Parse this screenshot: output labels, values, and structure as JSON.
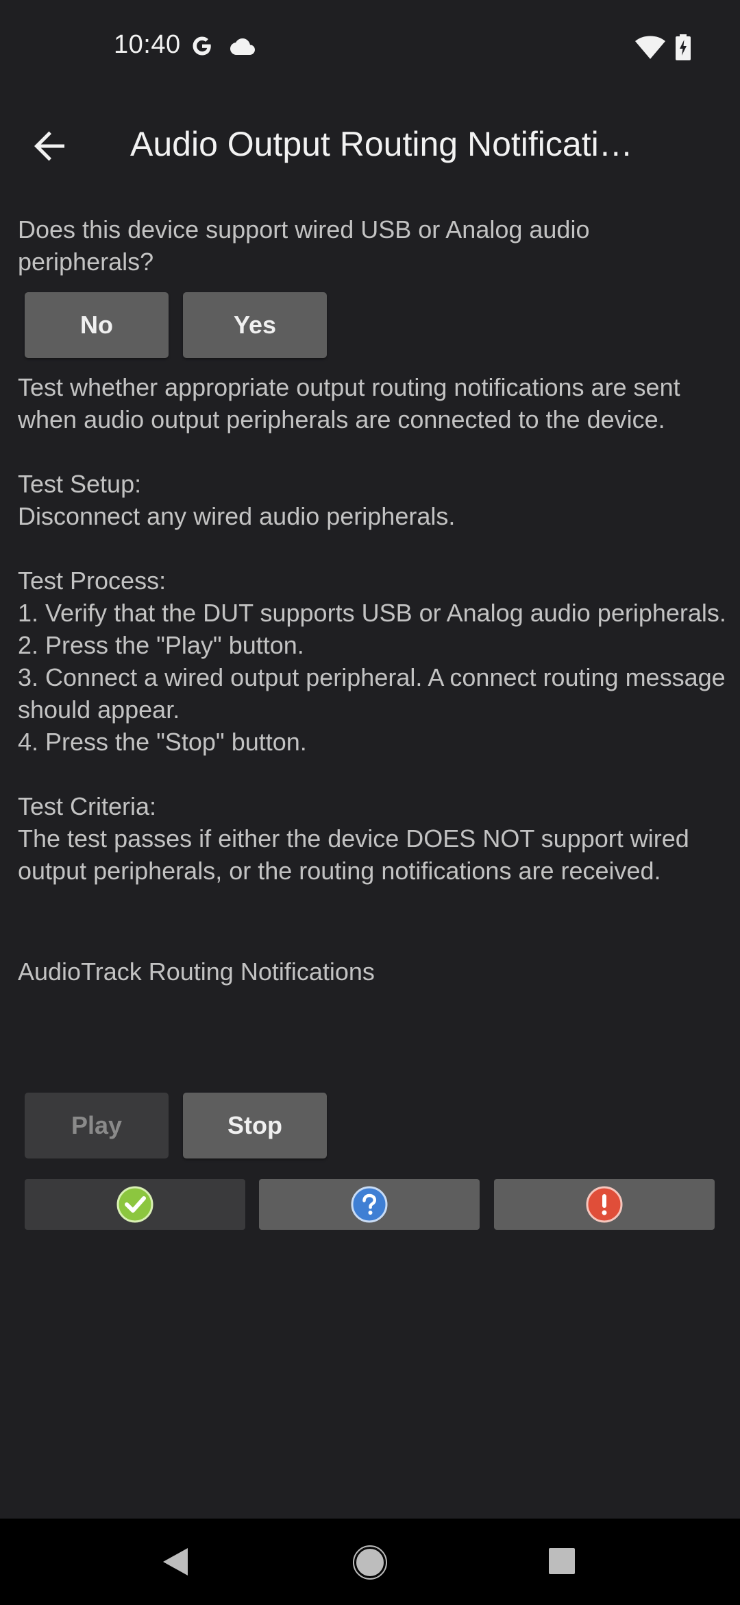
{
  "status_bar": {
    "time": "10:40",
    "icons": [
      "google-g-icon",
      "cloud-icon",
      "wifi-icon",
      "battery-charging-icon"
    ]
  },
  "app_bar": {
    "title": "Audio Output Routing Notificati…",
    "back_icon": "arrow-back-icon"
  },
  "question": {
    "text": "Does this device support wired USB or Analog audio peripherals?",
    "no_label": "No",
    "yes_label": "Yes"
  },
  "instructions": {
    "text": "Test whether appropriate output routing notifications are sent when audio output peripherals are connected to the device.\n\nTest Setup:\nDisconnect any wired audio peripherals.\n\nTest Process:\n1. Verify that the DUT supports USB or Analog audio peripherals.\n2. Press the \"Play\" button.\n3. Connect a wired output peripheral. A connect routing message should appear.\n4. Press the \"Stop\" button.\n\nTest Criteria:\nThe test passes if either the device DOES NOT support wired output peripherals, or the routing notifications are received."
  },
  "routing": {
    "title": "AudioTrack Routing Notifications"
  },
  "controls": {
    "play_label": "Play",
    "stop_label": "Stop"
  },
  "results": {
    "pass_icon": "check-circle-icon",
    "info_icon": "question-circle-icon",
    "fail_icon": "exclamation-circle-icon"
  },
  "colors": {
    "background": "#1f1f22",
    "button": "#5e5e5e",
    "button_disabled": "#3a3a3c",
    "pass": "#8cc63f",
    "info": "#3f7fd4",
    "fail": "#e04e39"
  },
  "nav_bar": {
    "icons": [
      "nav-back-icon",
      "nav-home-icon",
      "nav-recents-icon"
    ]
  }
}
